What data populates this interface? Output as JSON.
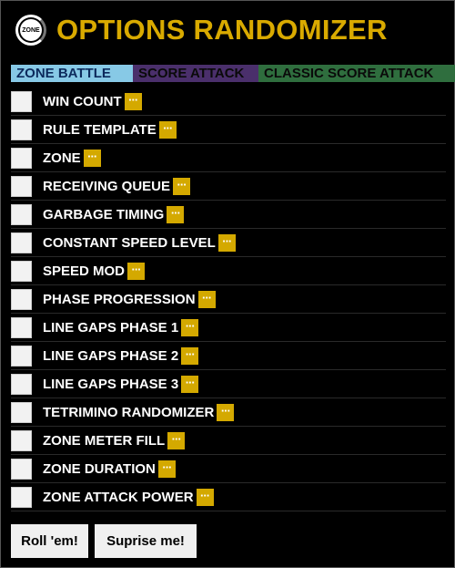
{
  "header": {
    "logo_text": "ZONE",
    "title": "OPTIONS RANDOMIZER"
  },
  "tabs": [
    {
      "label": "ZONE BATTLE",
      "color": "#87c9e6"
    },
    {
      "label": "SCORE ATTACK",
      "color": "#4a2f6b"
    },
    {
      "label": "CLASSIC SCORE ATTACK",
      "color": "#2f6e3e"
    }
  ],
  "options": [
    {
      "label": "WIN COUNT",
      "more": "···"
    },
    {
      "label": "RULE TEMPLATE",
      "more": "···"
    },
    {
      "label": "ZONE",
      "more": "···"
    },
    {
      "label": "RECEIVING QUEUE",
      "more": "···"
    },
    {
      "label": "GARBAGE TIMING",
      "more": "···"
    },
    {
      "label": "CONSTANT SPEED LEVEL",
      "more": "···"
    },
    {
      "label": "SPEED MOD",
      "more": "···"
    },
    {
      "label": "PHASE PROGRESSION",
      "more": "···"
    },
    {
      "label": "LINE GAPS PHASE 1",
      "more": "···"
    },
    {
      "label": "LINE GAPS PHASE 2",
      "more": "···"
    },
    {
      "label": "LINE GAPS PHASE 3",
      "more": "···"
    },
    {
      "label": "TETRIMINO RANDOMIZER",
      "more": "···"
    },
    {
      "label": "ZONE METER FILL",
      "more": "···"
    },
    {
      "label": "ZONE DURATION",
      "more": "···"
    },
    {
      "label": "ZONE ATTACK POWER",
      "more": "···"
    }
  ],
  "buttons": {
    "roll_label": "Roll 'em!",
    "surprise_label": "Suprise me!"
  },
  "colors": {
    "title": "#d9aa00",
    "more_button": "#d4a900",
    "background": "#000000"
  }
}
